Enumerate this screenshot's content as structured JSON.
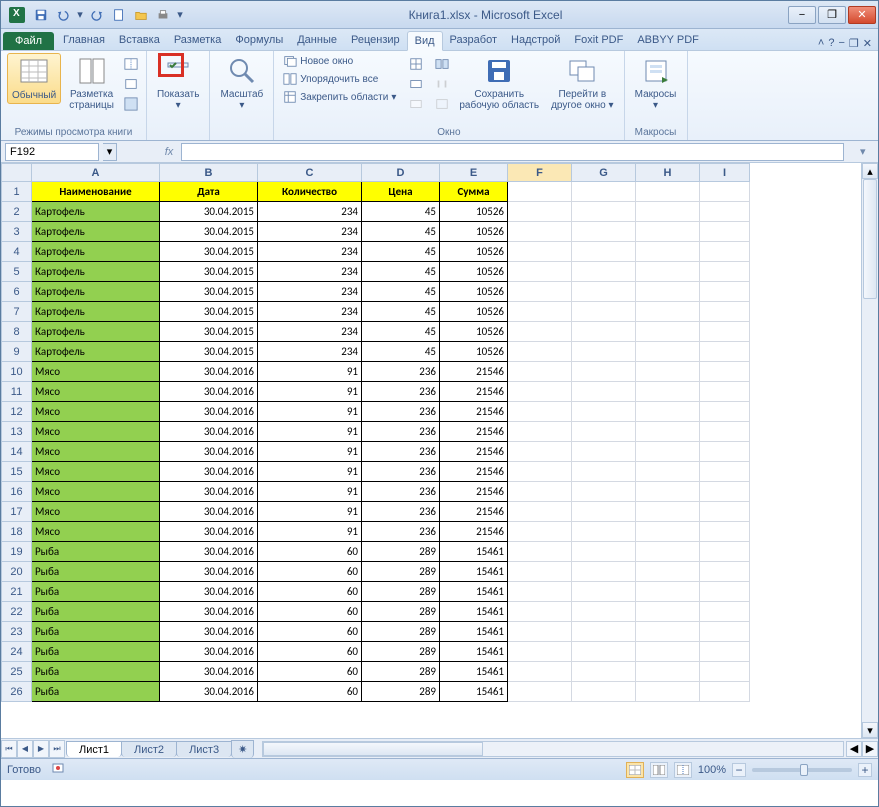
{
  "title": "Книга1.xlsx - Microsoft Excel",
  "qat": {
    "save": "save-icon",
    "undo": "undo-icon",
    "redo": "redo-icon",
    "new": "new-icon",
    "open": "open-icon",
    "print": "quickprint-icon"
  },
  "win": {
    "min": "−",
    "max": "❐",
    "close": "✕"
  },
  "tabs": {
    "file": "Файл",
    "items": [
      "Главная",
      "Вставка",
      "Разметка",
      "Формулы",
      "Данные",
      "Рецензир",
      "Вид",
      "Разработ",
      "Надстрой",
      "Foxit PDF",
      "ABBYY PDF"
    ],
    "active_index": 6
  },
  "ribbon_help": {
    "minimize": "˄",
    "help": "?",
    "mdi_min": "−",
    "mdi_max": "❐",
    "mdi_close": "✕"
  },
  "ribbon": {
    "views_group_label": "Режимы просмотра книги",
    "normal": "Обычный",
    "page_layout": "Разметка\nстраницы",
    "show": "Показать",
    "zoom": "Масштаб",
    "window_group_label": "Окно",
    "new_window": "Новое окно",
    "arrange_all": "Упорядочить все",
    "freeze": "Закрепить области",
    "save_workspace": "Сохранить\nрабочую область",
    "switch_windows": "Перейти в\nдругое окно",
    "macros_group_label": "Макросы",
    "macros": "Макросы"
  },
  "name_box": "F192",
  "fx": "fx",
  "columns": [
    "A",
    "B",
    "C",
    "D",
    "E",
    "F",
    "G",
    "H",
    "I"
  ],
  "selected_col": "F",
  "headers": [
    "Наименование",
    "Дата",
    "Количество",
    "Цена",
    "Сумма"
  ],
  "rows": [
    {
      "n": "Картофель",
      "d": "30.04.2015",
      "k": 234,
      "c": 45,
      "s": 10526
    },
    {
      "n": "Картофель",
      "d": "30.04.2015",
      "k": 234,
      "c": 45,
      "s": 10526
    },
    {
      "n": "Картофель",
      "d": "30.04.2015",
      "k": 234,
      "c": 45,
      "s": 10526
    },
    {
      "n": "Картофель",
      "d": "30.04.2015",
      "k": 234,
      "c": 45,
      "s": 10526
    },
    {
      "n": "Картофель",
      "d": "30.04.2015",
      "k": 234,
      "c": 45,
      "s": 10526
    },
    {
      "n": "Картофель",
      "d": "30.04.2015",
      "k": 234,
      "c": 45,
      "s": 10526
    },
    {
      "n": "Картофель",
      "d": "30.04.2015",
      "k": 234,
      "c": 45,
      "s": 10526
    },
    {
      "n": "Картофель",
      "d": "30.04.2015",
      "k": 234,
      "c": 45,
      "s": 10526
    },
    {
      "n": "Мясо",
      "d": "30.04.2016",
      "k": 91,
      "c": 236,
      "s": 21546
    },
    {
      "n": "Мясо",
      "d": "30.04.2016",
      "k": 91,
      "c": 236,
      "s": 21546
    },
    {
      "n": "Мясо",
      "d": "30.04.2016",
      "k": 91,
      "c": 236,
      "s": 21546
    },
    {
      "n": "Мясо",
      "d": "30.04.2016",
      "k": 91,
      "c": 236,
      "s": 21546
    },
    {
      "n": "Мясо",
      "d": "30.04.2016",
      "k": 91,
      "c": 236,
      "s": 21546
    },
    {
      "n": "Мясо",
      "d": "30.04.2016",
      "k": 91,
      "c": 236,
      "s": 21546
    },
    {
      "n": "Мясо",
      "d": "30.04.2016",
      "k": 91,
      "c": 236,
      "s": 21546
    },
    {
      "n": "Мясо",
      "d": "30.04.2016",
      "k": 91,
      "c": 236,
      "s": 21546
    },
    {
      "n": "Мясо",
      "d": "30.04.2016",
      "k": 91,
      "c": 236,
      "s": 21546
    },
    {
      "n": "Рыба",
      "d": "30.04.2016",
      "k": 60,
      "c": 289,
      "s": 15461
    },
    {
      "n": "Рыба",
      "d": "30.04.2016",
      "k": 60,
      "c": 289,
      "s": 15461
    },
    {
      "n": "Рыба",
      "d": "30.04.2016",
      "k": 60,
      "c": 289,
      "s": 15461
    },
    {
      "n": "Рыба",
      "d": "30.04.2016",
      "k": 60,
      "c": 289,
      "s": 15461
    },
    {
      "n": "Рыба",
      "d": "30.04.2016",
      "k": 60,
      "c": 289,
      "s": 15461
    },
    {
      "n": "Рыба",
      "d": "30.04.2016",
      "k": 60,
      "c": 289,
      "s": 15461
    },
    {
      "n": "Рыба",
      "d": "30.04.2016",
      "k": 60,
      "c": 289,
      "s": 15461
    },
    {
      "n": "Рыба",
      "d": "30.04.2016",
      "k": 60,
      "c": 289,
      "s": 15461
    }
  ],
  "sheets": [
    "Лист1",
    "Лист2",
    "Лист3"
  ],
  "active_sheet": 0,
  "status": {
    "ready": "Готово",
    "zoom": "100%",
    "plus": "+",
    "minus": "−"
  }
}
